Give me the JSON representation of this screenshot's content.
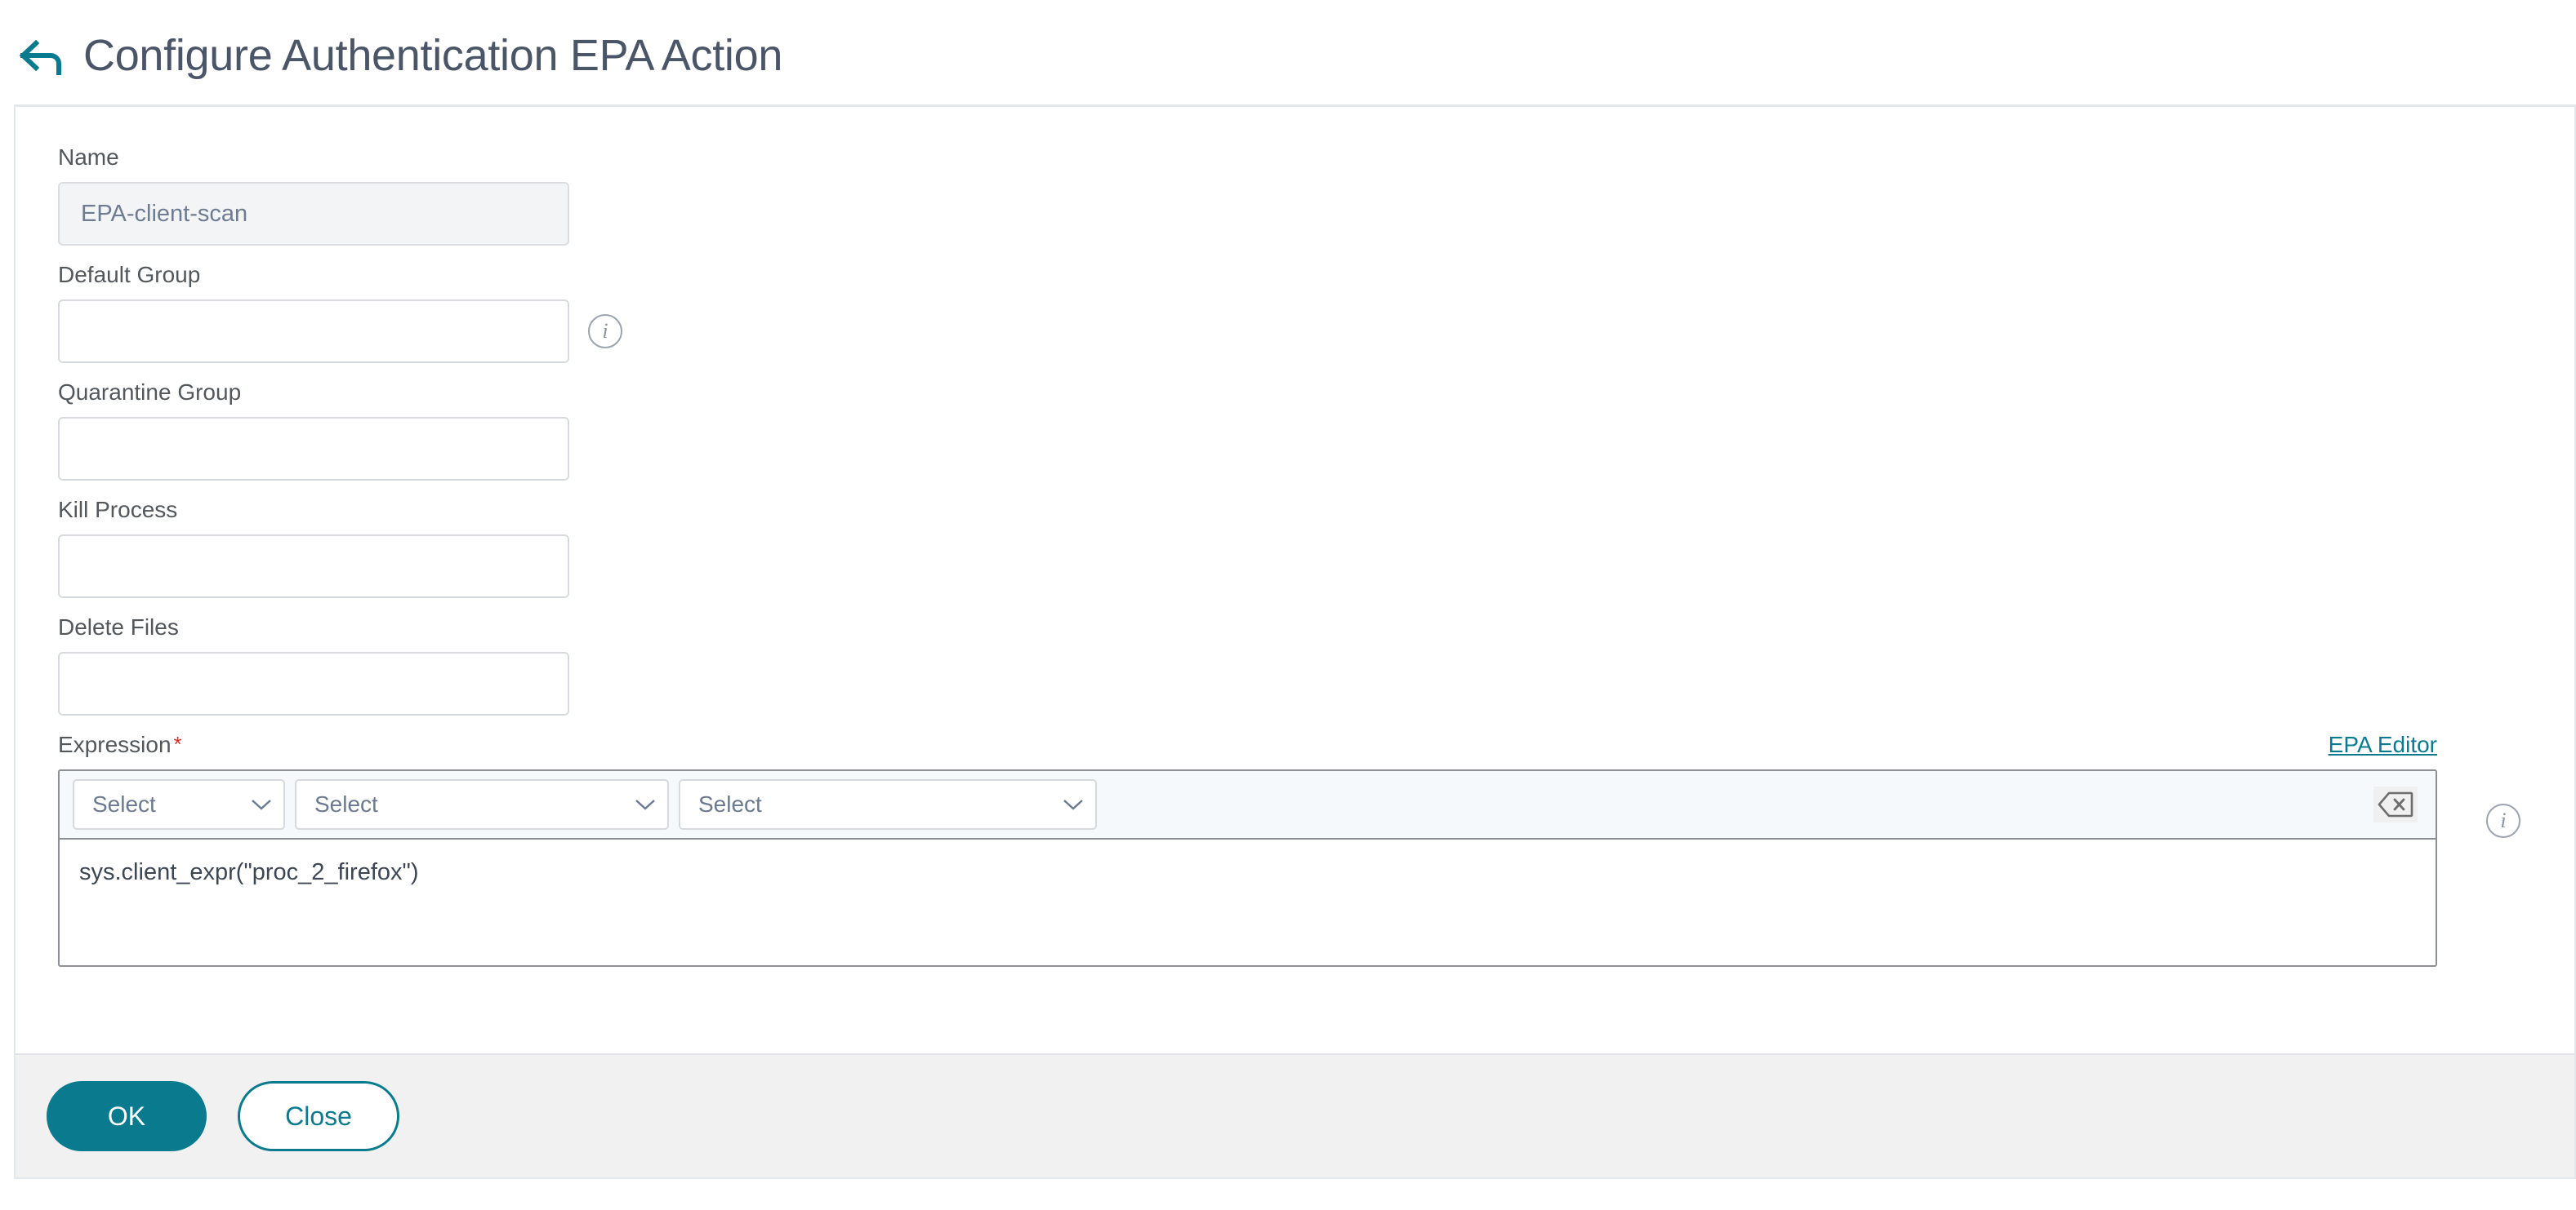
{
  "header": {
    "back_icon": "back-arrow-icon",
    "title": "Configure Authentication EPA Action",
    "accent_color": "#0a7b8f"
  },
  "form": {
    "fields": [
      {
        "label": "Name",
        "value": "EPA-client-scan",
        "placeholder": "",
        "disabled": true,
        "has_info": false
      },
      {
        "label": "Default Group",
        "value": "",
        "placeholder": "",
        "disabled": false,
        "has_info": true
      },
      {
        "label": "Quarantine Group",
        "value": "",
        "placeholder": "",
        "disabled": false,
        "has_info": false
      },
      {
        "label": "Kill Process",
        "value": "",
        "placeholder": "",
        "disabled": false,
        "has_info": false
      },
      {
        "label": "Delete Files",
        "value": "",
        "placeholder": "",
        "disabled": false,
        "has_info": false
      }
    ]
  },
  "expression": {
    "label": "Expression",
    "required_marker": "*",
    "editor_link": "EPA Editor",
    "selects": [
      {
        "label": "Select",
        "icon": "chevron-down-icon"
      },
      {
        "label": "Select",
        "icon": "chevron-down-icon"
      },
      {
        "label": "Select",
        "icon": "chevron-down-icon"
      }
    ],
    "clear_icon": "erase-backspace-icon",
    "value": "sys.client_expr(\"proc_2_firefox\")",
    "placeholder": "",
    "info_icon": "info-icon"
  },
  "footer": {
    "ok_label": "OK",
    "close_label": "Close",
    "primary_color": "#0a7b8f"
  }
}
